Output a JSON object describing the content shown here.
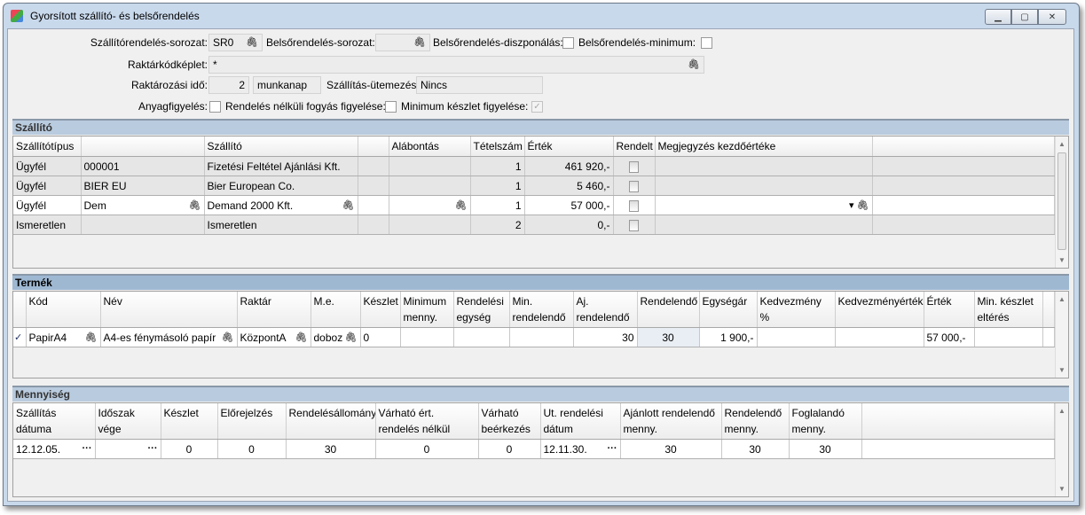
{
  "window": {
    "title": "Gyorsított szállító- és belsőrendelés",
    "controls": [
      "minimize",
      "maximize",
      "close"
    ]
  },
  "form": {
    "supplier_series_label": "Szállítórendelés-sorozat:",
    "supplier_series_value": "SR0",
    "internal_series_label": "Belsőrendelés-sorozat:",
    "internal_series_value": "",
    "internal_disposition_label": "Belsőrendelés-diszponálás:",
    "internal_disposition_checked": false,
    "internal_minimum_label": "Belsőrendelés-minimum:",
    "internal_minimum_checked": false,
    "warehouse_code_label": "Raktárkódképlet:",
    "warehouse_code_value": "*",
    "storage_time_label": "Raktározási idő:",
    "storage_time_value": "2",
    "storage_time_unit": "munkanap",
    "schedule_label": "Szállítás-ütemezés:",
    "schedule_value": "Nincs",
    "material_watch_label": "Anyagfigyelés:",
    "material_watch_checked": false,
    "no_order_consumption_label": "Rendelés nélküli fogyás figyelése:",
    "no_order_consumption_checked": false,
    "min_stock_label": "Minimum készlet figyelése:",
    "min_stock_checked": true
  },
  "suppliers": {
    "title": "Szállító",
    "columns": [
      "Szállítótípus",
      "",
      "Szállító",
      "",
      "Alábontás",
      "Tételszám",
      "Érték",
      "Rendelt",
      "Megjegyzés kezdőértéke",
      ""
    ],
    "rows": [
      [
        "Ügyfél",
        "000001",
        "Fizetési Feltétel Ajánlási Kft.",
        "",
        "",
        "1",
        "461 920,-",
        "",
        "",
        ""
      ],
      [
        "Ügyfél",
        "BIER EU",
        "Bier European Co.",
        "",
        "",
        "1",
        "5 460,-",
        "",
        "",
        ""
      ],
      [
        "Ügyfél",
        "Dem",
        "Demand 2000 Kft.",
        "",
        "",
        "1",
        "57 000,-",
        "",
        "",
        ""
      ],
      [
        "Ismeretlen",
        "",
        "Ismeretlen",
        "",
        "",
        "2",
        "0,-",
        "",
        "",
        ""
      ]
    ]
  },
  "products": {
    "title": "Termék",
    "columns": [
      "",
      "Kód",
      "Név",
      "Raktár",
      "M.e.",
      "Készlet",
      "Minimum menny.",
      "Rendelési egység",
      "Min. rendelendő",
      "Aj. rendelendő",
      "Rendelendő",
      "Egységár",
      "Kedvezmény %",
      "Kedvezményérték",
      "Érték",
      "Min. készlet eltérés",
      ""
    ],
    "rows": [
      [
        "✓",
        "PapirA4",
        "A4-es fénymásoló papír",
        "KözpontA",
        "doboz",
        "0",
        "",
        "",
        "",
        "30",
        "30",
        "1 900,-",
        "",
        "",
        "57 000,-",
        "",
        ""
      ]
    ]
  },
  "quantity": {
    "title": "Mennyiség",
    "columns": [
      "Szállítás dátuma",
      "Időszak vége",
      "Készlet",
      "Előrejelzés",
      "Rendelésállomány",
      "Várható ért. rendelés nélkül",
      "Várható beérkezés",
      "Ut. rendelési dátum",
      "Ajánlott rendelendő menny.",
      "Rendelendő menny.",
      "Foglalandó menny.",
      ""
    ],
    "rows": [
      [
        "12.12.05.",
        "",
        "0",
        "0",
        "30",
        "0",
        "0",
        "12.11.30.",
        "30",
        "30",
        "30",
        ""
      ]
    ]
  }
}
